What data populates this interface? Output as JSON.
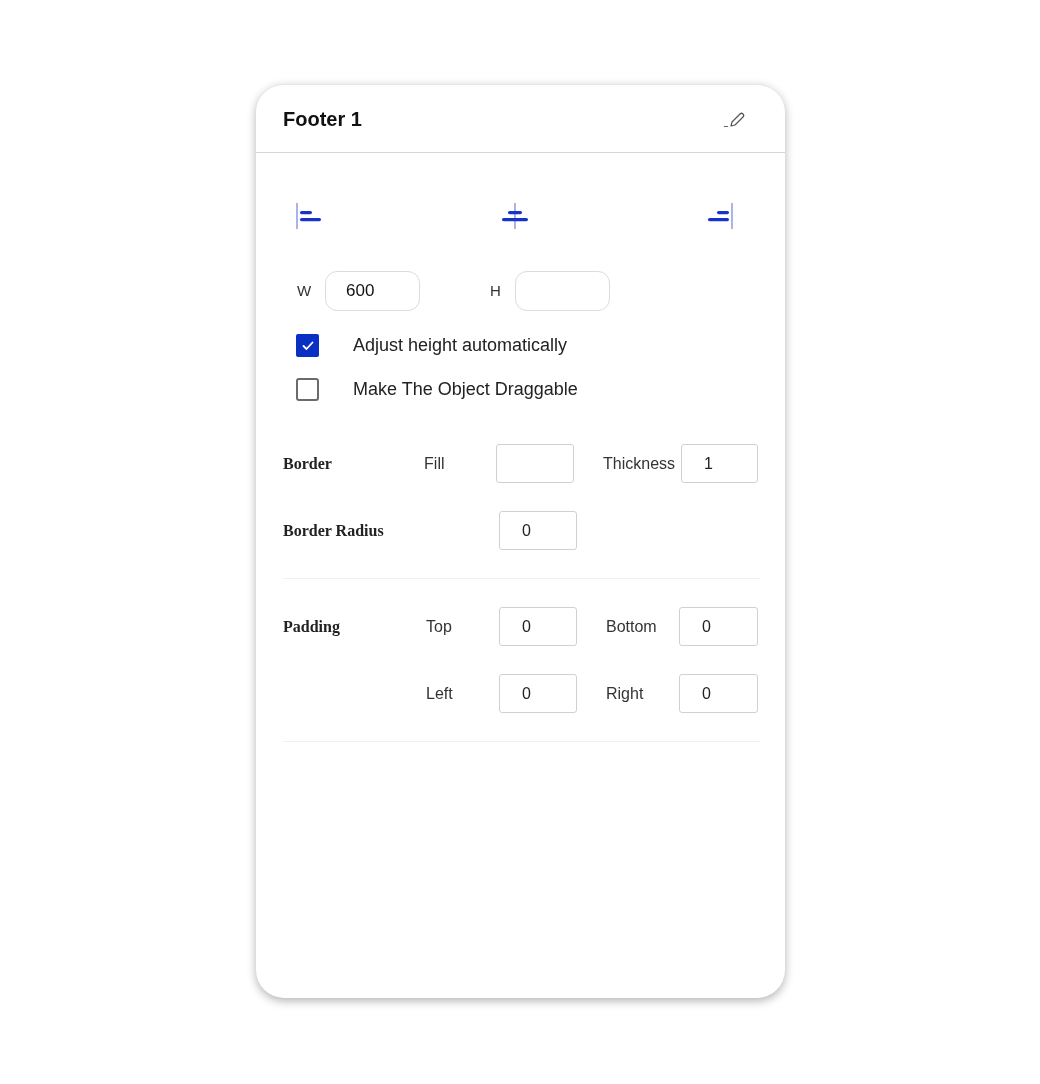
{
  "panel": {
    "title": "Footer 1"
  },
  "alignment_buttons": [
    {
      "kind": "left"
    },
    {
      "kind": "center"
    },
    {
      "kind": "right"
    }
  ],
  "size": [
    {
      "label": "W",
      "value": "600"
    },
    {
      "label": "H"
    }
  ],
  "options": [
    {
      "label": "Adjust height automatically",
      "checked": true
    },
    {
      "label": "Make The Object Draggable",
      "checked": false
    }
  ],
  "border": {
    "label": "Border",
    "fill": {
      "label": "Fill"
    },
    "thickness": {
      "label": "Thickness",
      "value": "1"
    }
  },
  "border_radius": {
    "label": "Border Radius",
    "value": "0"
  },
  "padding": {
    "label": "Padding",
    "fields": [
      {
        "label": "Top",
        "value": "0"
      },
      {
        "label": "Bottom",
        "value": "0"
      },
      {
        "label": "Left",
        "value": "0"
      },
      {
        "label": "Right",
        "value": "0"
      }
    ]
  }
}
